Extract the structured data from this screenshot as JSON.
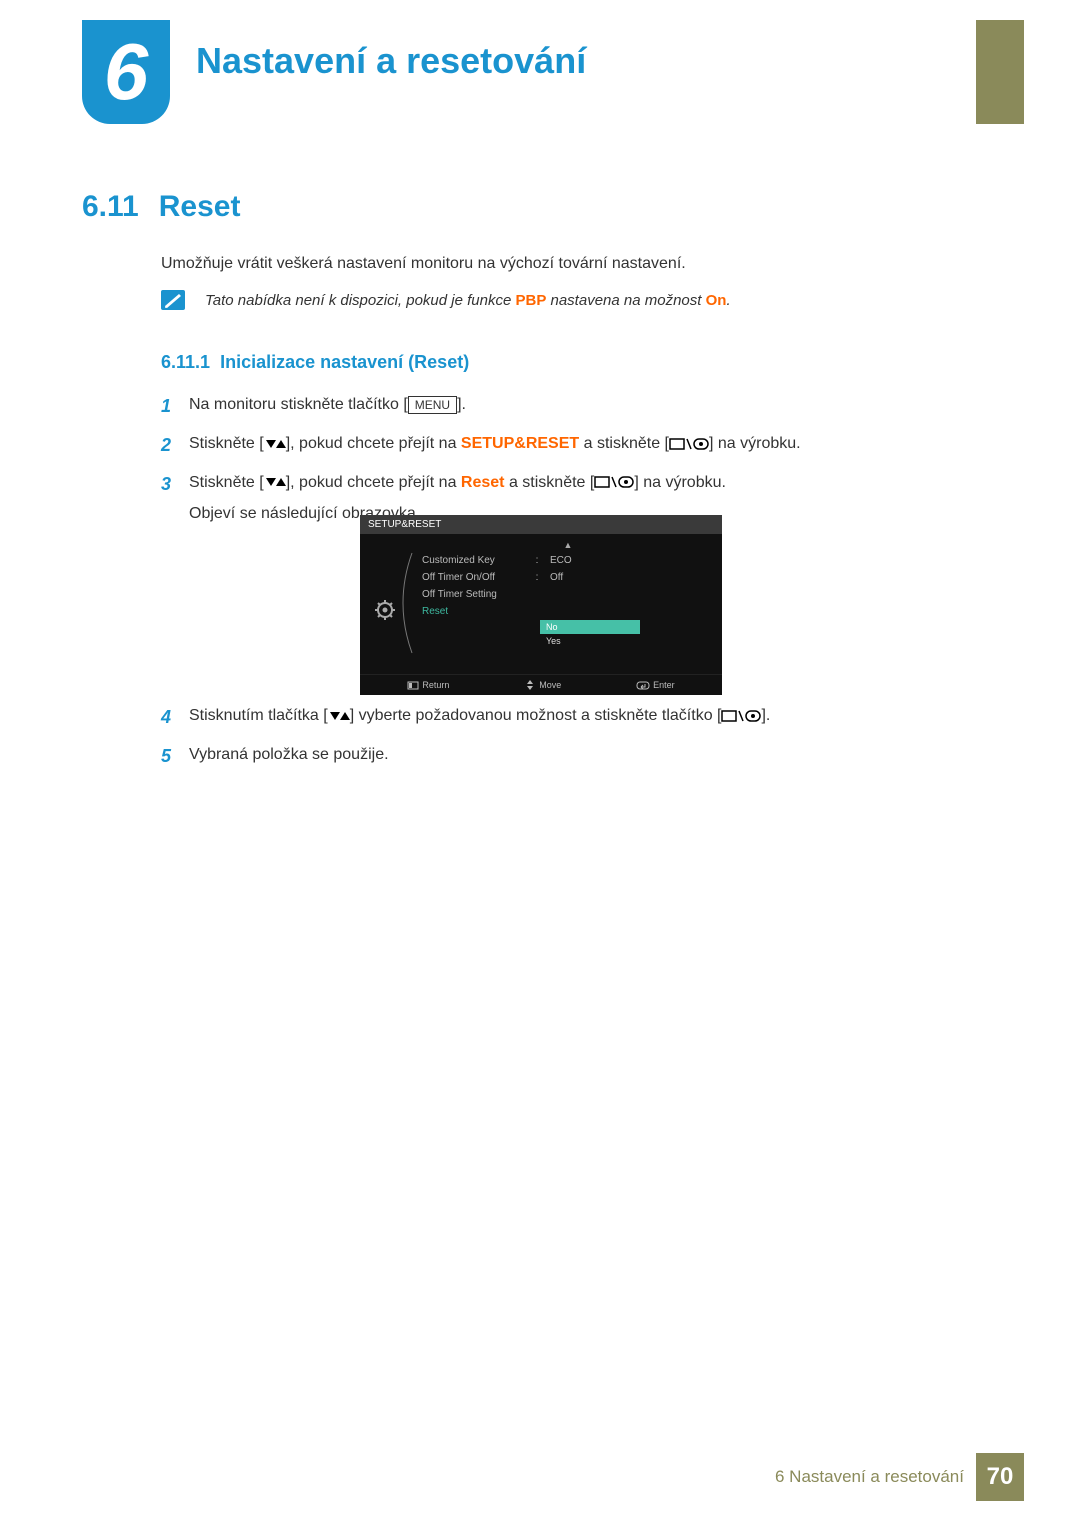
{
  "chapter": {
    "number": "6",
    "title": "Nastavení a resetování"
  },
  "section": {
    "number": "6.11",
    "title": "Reset",
    "intro": "Umožňuje vrátit veškerá nastavení monitoru na výchozí tovární nastavení.",
    "note_pre": "Tato nabídka není k dispozici, pokud je funkce ",
    "note_hl1": "PBP",
    "note_mid": " nastavena na možnost ",
    "note_hl2": "On",
    "note_post": "."
  },
  "subsection": {
    "number": "6.11.1",
    "title": "Inicializace nastavení (Reset)"
  },
  "steps": {
    "s1_pre": "Na monitoru stiskněte tlačítko [",
    "s1_btn": "MENU",
    "s1_post": "].",
    "s2_pre": "Stiskněte [",
    "s2_mid1": "], pokud chcete přejít na ",
    "s2_hl": "SETUP&RESET",
    "s2_mid2": " a stiskněte [",
    "s2_post": "] na výrobku.",
    "s3_pre": "Stiskněte [",
    "s3_mid1": "], pokud chcete přejít na ",
    "s3_hl": "Reset",
    "s3_mid2": " a stiskněte [",
    "s3_post": "] na výrobku.",
    "s3_after": "Objeví se následující obrazovka.",
    "s4_pre": "Stisknutím tlačítka [",
    "s4_mid": "] vyberte požadovanou možnost a stiskněte tlačítko [",
    "s4_post": "].",
    "s5": "Vybraná položka se použije."
  },
  "osd": {
    "title": "SETUP&RESET",
    "rows": [
      {
        "label": "Customized Key",
        "value": "ECO"
      },
      {
        "label": "Off Timer On/Off",
        "value": "Off"
      },
      {
        "label": "Off Timer Setting",
        "value": ""
      },
      {
        "label": "Reset",
        "value": ""
      }
    ],
    "options": {
      "no": "No",
      "yes": "Yes"
    },
    "footer": {
      "return": "Return",
      "move": "Move",
      "enter": "Enter"
    }
  },
  "footer": {
    "text": "6 Nastavení a resetování",
    "page": "70"
  }
}
